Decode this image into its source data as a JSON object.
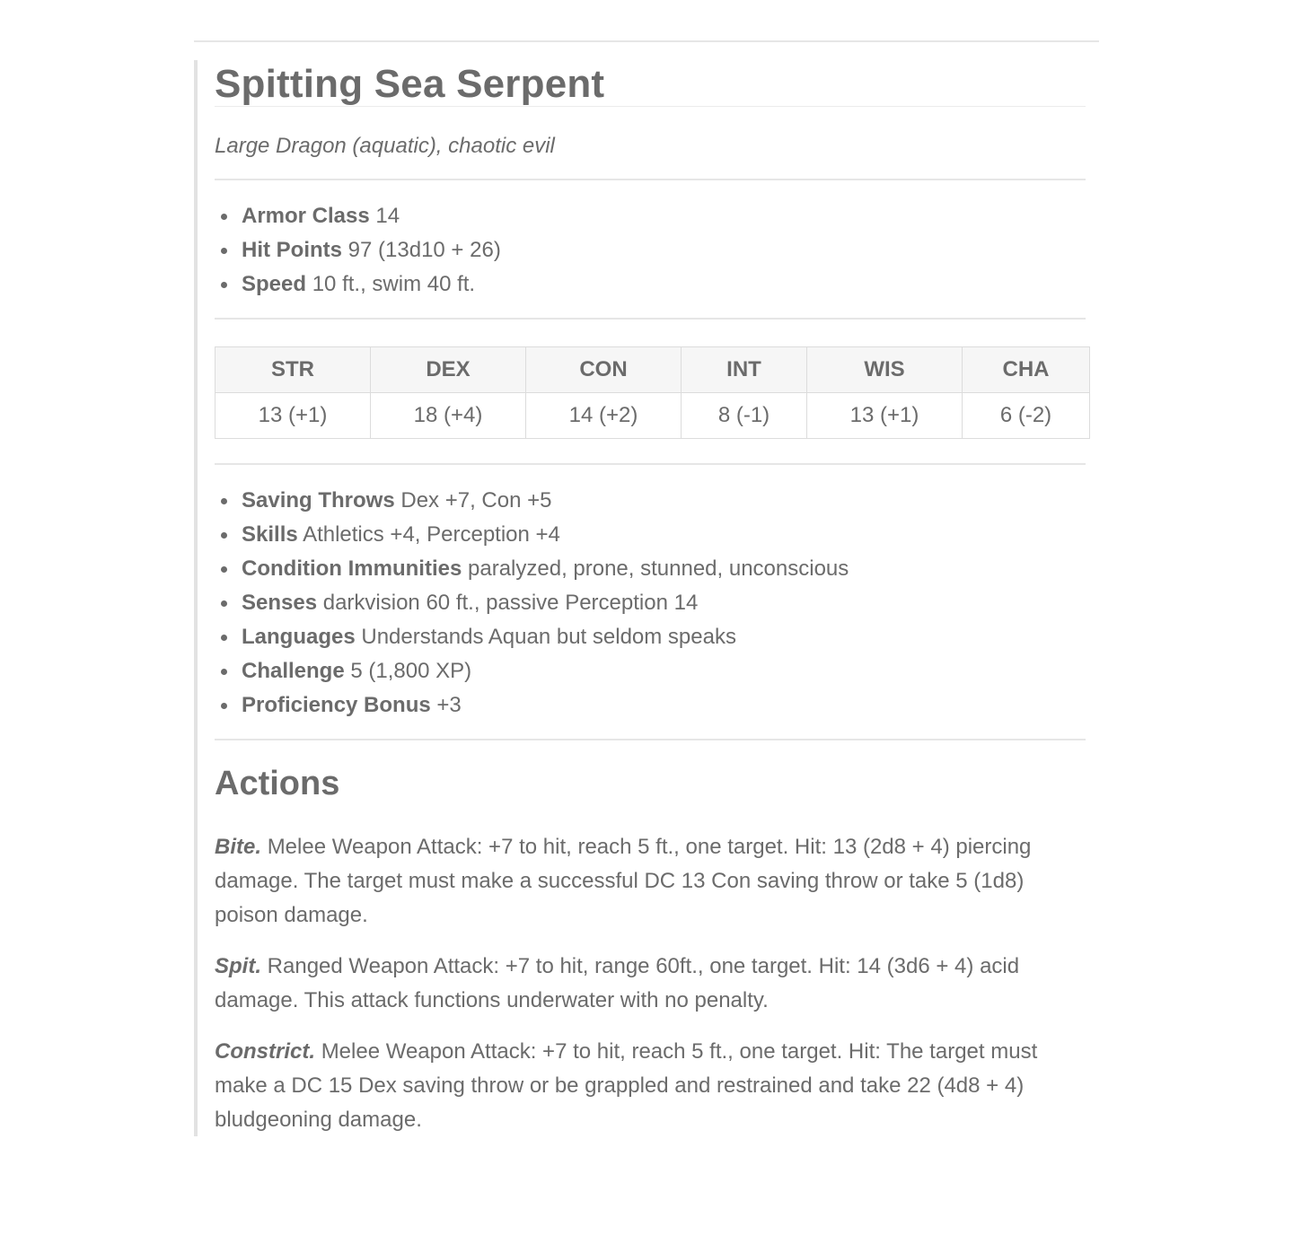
{
  "monster": {
    "name": "Spitting Sea Serpent",
    "meta": "Large Dragon (aquatic), chaotic evil"
  },
  "basics": [
    {
      "label": "Armor Class",
      "value": "14"
    },
    {
      "label": "Hit Points",
      "value": "97 (13d10 + 26)"
    },
    {
      "label": "Speed",
      "value": "10 ft., swim 40 ft."
    }
  ],
  "abilities": {
    "headers": [
      "STR",
      "DEX",
      "CON",
      "INT",
      "WIS",
      "CHA"
    ],
    "values": [
      "13 (+1)",
      "18 (+4)",
      "14 (+2)",
      "8 (-1)",
      "13 (+1)",
      "6 (-2)"
    ]
  },
  "details": [
    {
      "label": "Saving Throws",
      "value": "Dex +7, Con +5"
    },
    {
      "label": "Skills",
      "value": "Athletics +4, Perception +4"
    },
    {
      "label": "Condition Immunities",
      "value": "paralyzed, prone, stunned, unconscious"
    },
    {
      "label": "Senses",
      "value": "darkvision 60 ft., passive Perception 14"
    },
    {
      "label": "Languages",
      "value": "Understands Aquan but seldom speaks"
    },
    {
      "label": "Challenge",
      "value": "5 (1,800 XP)"
    },
    {
      "label": "Proficiency Bonus",
      "value": "+3"
    }
  ],
  "actions": {
    "heading": "Actions",
    "items": [
      {
        "name": "Bite.",
        "text": "Melee Weapon Attack: +7 to hit, reach 5 ft., one target. Hit: 13 (2d8 + 4) piercing damage. The target must make a successful DC 13 Con saving throw or take 5 (1d8) poison damage."
      },
      {
        "name": "Spit.",
        "text": "Ranged Weapon Attack: +7 to hit, range 60ft., one target. Hit: 14 (3d6 + 4) acid damage. This attack functions underwater with no penalty."
      },
      {
        "name": "Constrict.",
        "text": "Melee Weapon Attack: +7 to hit, reach 5 ft., one target. Hit: The target must make a DC 15 Dex saving throw or be grappled and restrained and take 22 (4d8 + 4) bludgeoning damage."
      }
    ]
  }
}
